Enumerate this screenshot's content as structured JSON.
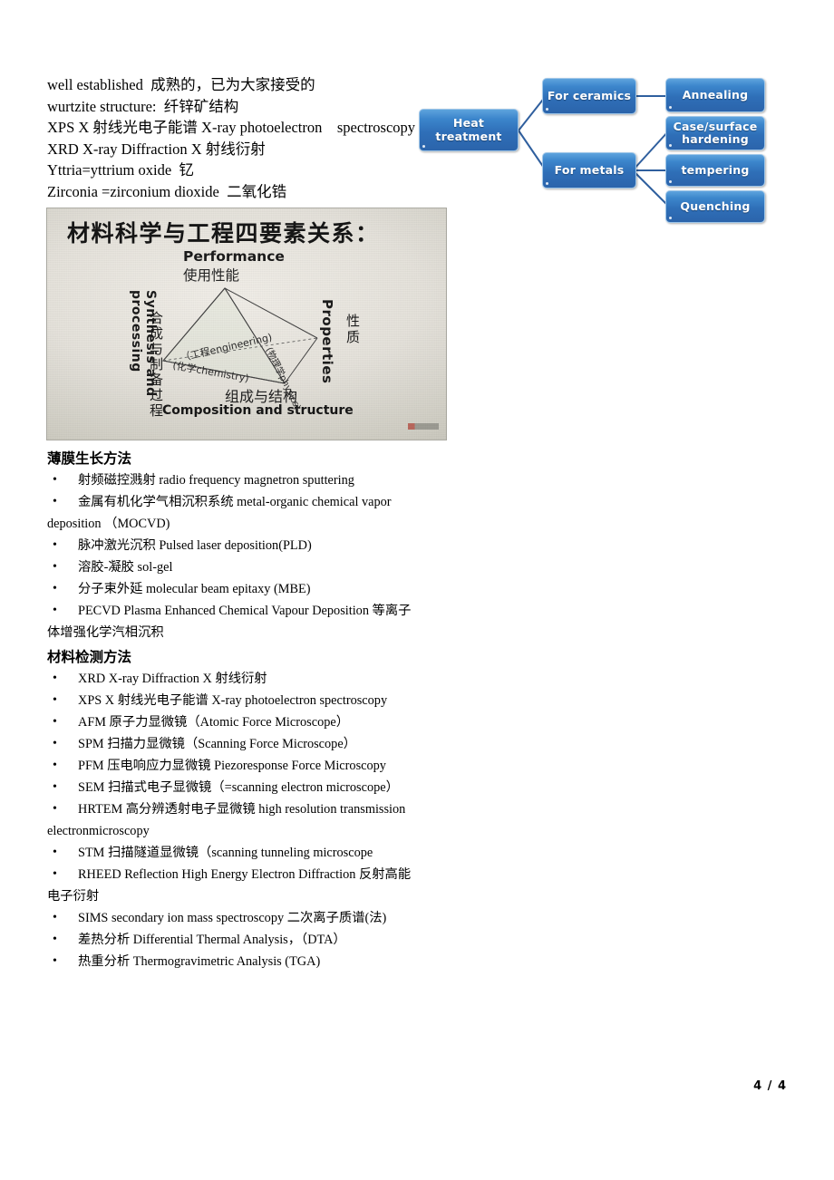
{
  "document": {
    "page_label": "4 / 4"
  },
  "top_notes": {
    "lines": [
      "well established  成熟的，已为大家接受的",
      "wurtzite structure:  纤锌矿结构",
      "XPS X 射线光电子能谱 X-ray photoelectron    spectroscopy",
      "XRD X-ray Diffraction X 射线衍射",
      "Yttria=yttrium oxide  钇",
      "Zirconia =zirconium dioxide  二氧化锆"
    ]
  },
  "heat_diagram": {
    "root": "Heat treatment",
    "root_lines": [
      "Heat",
      "treatment"
    ],
    "branches": [
      {
        "label": "For ceramics",
        "children": [
          "Annealing"
        ]
      },
      {
        "label": "For metals",
        "children": [
          "Case/surface hardening",
          "tempering",
          "Quenching"
        ]
      }
    ],
    "nodes": {
      "root": "Heat\ntreatment",
      "ceramics": "For ceramics",
      "metals": "For metals",
      "annealing": "Annealing",
      "case_hardening_l1": "Case/surface",
      "case_hardening_l2": "hardening",
      "tempering": "tempering",
      "quenching": "Quenching"
    },
    "colors": {
      "box_fill_top": "#5ea3dd",
      "box_fill_bottom": "#2b64ab",
      "box_border": "#9fc6e8",
      "connector": "#2f5f9e",
      "text": "#ffffff"
    }
  },
  "slide_photo": {
    "title": "材料科学与工程四要素关系：",
    "vertex_performance_en": "Performance",
    "vertex_performance_cn": "使用性能",
    "vertex_composition_en": "Composition and structure",
    "vertex_composition_cn": "组成与结构",
    "vertex_synthesis_en": "Synthesis and processing",
    "vertex_synthesis_cn": "合成与制备过程",
    "vertex_properties_en": "Properties",
    "vertex_properties_cn": "性质",
    "edge_engineering": "（工程engineering)",
    "edge_chemistry": "(化学chemistry)",
    "edge_physics": "(物理学physics)"
  },
  "section_growth": {
    "heading": "薄膜生长方法",
    "bullet": "•",
    "items": [
      {
        "text": "射频磁控溅射 radio frequency magnetron sputtering",
        "cont": ""
      },
      {
        "text": "金属有机化学气相沉积系统 metal-organic chemical vapor",
        "cont": "deposition  （MOCVD)"
      },
      {
        "text": "脉冲激光沉积 Pulsed laser deposition(PLD)",
        "cont": ""
      },
      {
        "text": "溶胶-凝胶 sol-gel",
        "cont": ""
      },
      {
        "text": "分子束外延 molecular beam epitaxy (MBE)",
        "cont": ""
      },
      {
        "text": "PECVD Plasma Enhanced Chemical Vapour Deposition  等离子",
        "cont": "体增强化学汽相沉积"
      }
    ]
  },
  "section_characterization": {
    "heading": "材料检测方法",
    "bullet": "•",
    "items": [
      {
        "text": "XRD X-ray Diffraction X 射线衍射",
        "cont": ""
      },
      {
        "text": "XPS   X 射线光电子能谱 X-ray photoelectron    spectroscopy",
        "cont": ""
      },
      {
        "text": "AFM 原子力显微镜（Atomic Force Microscope）",
        "cont": ""
      },
      {
        "text": "SPM 扫描力显微镜（Scanning Force Microscope）",
        "cont": ""
      },
      {
        "text": "PFM 压电响应力显微镜 Piezoresponse Force Microscopy",
        "cont": ""
      },
      {
        "text": "SEM 扫描式电子显微镜（=scanning electron microscope）",
        "cont": ""
      },
      {
        "text": "HRTEM 高分辨透射电子显微镜 high resolution transmission",
        "cont": "electronmicroscopy"
      },
      {
        "text": "STM 扫描隧道显微镜（scanning tunneling microscope",
        "cont": ""
      },
      {
        "text": "RHEED Reflection High Energy Electron Diffraction  反射高能",
        "cont": "电子衍射"
      },
      {
        "text": "SIMS secondary ion mass spectroscopy  二次离子质谱(法)",
        "cont": ""
      },
      {
        "text": "差热分析 Differential Thermal Analysis，（DTA）",
        "cont": ""
      },
      {
        "text": "热重分析 Thermogravimetric Analysis (TGA)",
        "cont": ""
      }
    ]
  }
}
